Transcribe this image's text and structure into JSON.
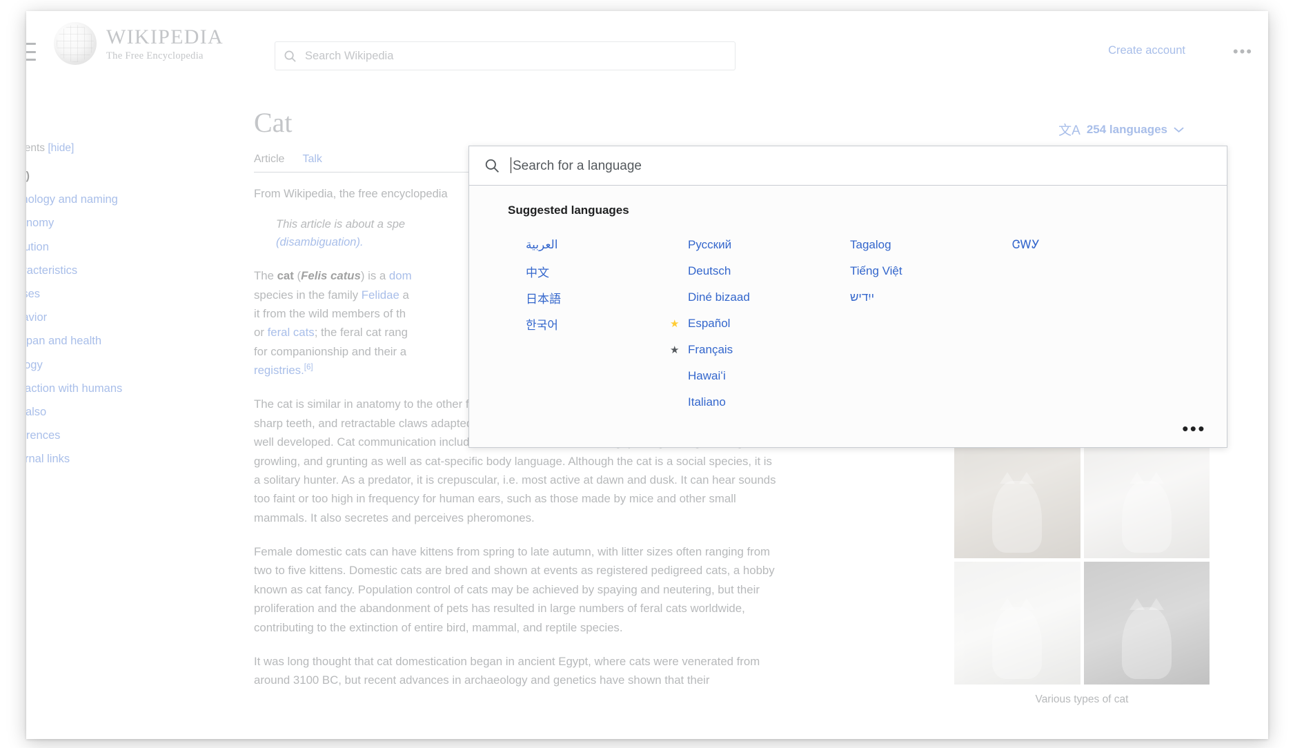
{
  "header": {
    "logo_word_top": "WIKIPEDIA",
    "logo_word_sub": "The Free Encyclopedia",
    "search_placeholder": "Search Wikipedia",
    "create_account": "Create account",
    "more_menu": "•••"
  },
  "sidebar": {
    "contents_label": "Contents",
    "hide_label": "[hide]",
    "items": [
      {
        "label": "(Top)",
        "active": true
      },
      {
        "label": "Etymology and naming"
      },
      {
        "label": "Taxonomy"
      },
      {
        "label": "Evolution"
      },
      {
        "label": "Characteristics"
      },
      {
        "label": "Senses"
      },
      {
        "label": "Behavior"
      },
      {
        "label": "Lifespan and health"
      },
      {
        "label": "Ecology"
      },
      {
        "label": "Interaction with humans"
      },
      {
        "label": "See also"
      },
      {
        "label": "References"
      },
      {
        "label": "External links"
      }
    ]
  },
  "article": {
    "title": "Cat",
    "tab_article": "Article",
    "tab_talk": "Talk",
    "from_wikipedia": "From Wikipedia, the free encyclopedia",
    "hatnote_1": "This article is about a spe",
    "hatnote_2": "(disambiguation).",
    "para1_a": "The ",
    "para1_cat": "cat",
    "para1_b": " (",
    "para1_felis": "Felis catus",
    "para1_c": ") is a ",
    "para1_dom": "dom",
    "para1_d": "species in the family ",
    "para1_felidae": "Felidae",
    "para1_e": " a",
    "para1_f": "it from the wild members of th",
    "para1_g": "or ",
    "para1_feral": "feral cats",
    "para1_h": "; the feral cat rang",
    "para1_i": "for companionship and their a",
    "para1_j": "registries.",
    "para1_ref": "[6]",
    "para2": "The cat is similar in anatomy to the other felid species: it has a strong flexible body, quick reflexes, and sharp teeth, and retractable claws adapted to killing small prey. Its night vision and sense of smell are well developed. Cat communication includes vocalizations like meowing, purring, trilling, hissing, growling, and grunting as well as cat-specific body language. Although the cat is a social species, it is a solitary hunter. As a predator, it is crepuscular, i.e. most active at dawn and dusk. It can hear sounds too faint or too high in frequency for human ears, such as those made by mice and other small mammals. It also secretes and perceives pheromones.",
    "para3": "Female domestic cats can have kittens from spring to late autumn, with litter sizes often ranging from two to five kittens. Domestic cats are bred and shown at events as registered pedigreed cats, a hobby known as cat fancy. Population control of cats may be achieved by spaying and neutering, but their proliferation and the abandonment of pets has resulted in large numbers of feral cats worldwide, contributing to the extinction of entire bird, mammal, and reptile species.",
    "para4": "It was long thought that cat domestication began in ancient Egypt, where cats were venerated from around 3100 BC, but recent advances in archaeology and genetics have shown that their"
  },
  "languages_button": {
    "glyph": "文A",
    "label": "254 languages",
    "chevron": "⌄"
  },
  "language_panel": {
    "search_placeholder": "Search for a language",
    "section_title": "Suggested languages",
    "more_button": "•••",
    "columns": [
      [
        {
          "label": "العربية",
          "star": "none",
          "rtl": true
        },
        {
          "label": "中文",
          "star": "none"
        },
        {
          "label": "日本語",
          "star": "none"
        },
        {
          "label": "한국어",
          "star": "none"
        }
      ],
      [
        {
          "label": "Русский",
          "star": "none"
        },
        {
          "label": "Deutsch",
          "star": "none"
        },
        {
          "label": "Diné bizaad",
          "star": "none"
        },
        {
          "label": "Español",
          "star": "gold"
        },
        {
          "label": "Français",
          "star": "grey"
        },
        {
          "label": "Hawaiʻi",
          "star": "none"
        },
        {
          "label": "Italiano",
          "star": "none"
        }
      ],
      [
        {
          "label": "Tagalog",
          "star": "none"
        },
        {
          "label": "Tiếng Việt",
          "star": "none"
        },
        {
          "label": "ייִדיש",
          "star": "none",
          "rtl": true
        }
      ],
      [
        {
          "label": "ᏣᎳᎩ",
          "star": "none"
        }
      ]
    ]
  },
  "infobox": {
    "caption": "Various types of cat"
  },
  "colors": {
    "link": "#3366cc",
    "text": "#202122",
    "muted": "#54595d",
    "star_gold": "#ffcc33",
    "star_grey": "#54595d"
  }
}
